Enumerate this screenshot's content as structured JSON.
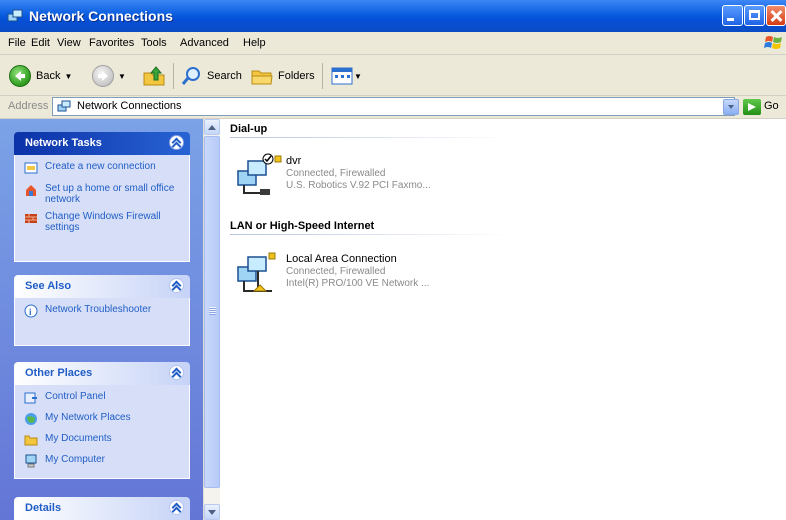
{
  "window": {
    "title": "Network Connections",
    "colors": {
      "titlebar": "#0a5ee0",
      "taskpane_link": "#215dc6"
    }
  },
  "menu": [
    "File",
    "Edit",
    "View",
    "Favorites",
    "Tools",
    "Advanced",
    "Help"
  ],
  "toolbar": {
    "back_label": "Back",
    "search_label": "Search",
    "folders_label": "Folders"
  },
  "address": {
    "label": "Address",
    "value": "Network Connections",
    "go_label": "Go"
  },
  "task_panes": [
    {
      "title": "Network Tasks",
      "items": [
        {
          "label": "Create a new connection",
          "icon": "new-connection-icon"
        },
        {
          "label": "Set up a home or small office network",
          "icon": "home-network-icon"
        },
        {
          "label": "Change Windows Firewall settings",
          "icon": "firewall-icon"
        }
      ]
    },
    {
      "title": "See Also",
      "items": [
        {
          "label": "Network Troubleshooter",
          "icon": "help-icon"
        }
      ]
    },
    {
      "title": "Other Places",
      "items": [
        {
          "label": "Control Panel",
          "icon": "control-panel-icon"
        },
        {
          "label": "My Network Places",
          "icon": "network-places-icon"
        },
        {
          "label": "My Documents",
          "icon": "folder-icon"
        },
        {
          "label": "My Computer",
          "icon": "computer-icon"
        }
      ]
    },
    {
      "title": "Details",
      "items": []
    }
  ],
  "groups": [
    {
      "title": "Dial-up",
      "connections": [
        {
          "name": "dvr",
          "status": "Connected, Firewalled",
          "device": "U.S. Robotics V.92 PCI Faxmo..."
        }
      ]
    },
    {
      "title": "LAN or High-Speed Internet",
      "connections": [
        {
          "name": "Local Area Connection",
          "status": "Connected, Firewalled",
          "device": "Intel(R) PRO/100 VE Network ..."
        }
      ]
    }
  ]
}
